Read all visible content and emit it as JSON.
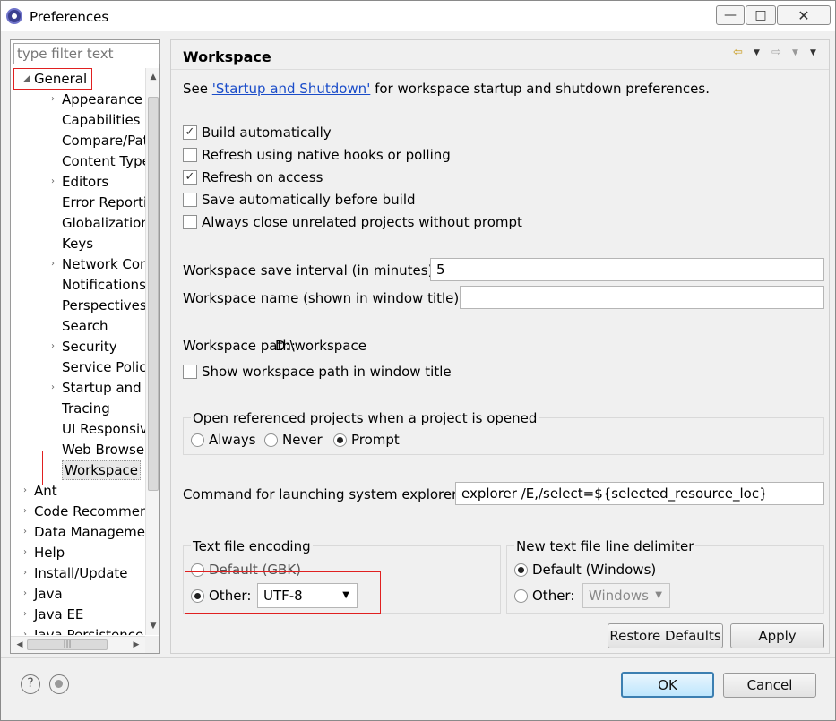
{
  "window": {
    "title": "Preferences",
    "controls": {
      "minimize": "—",
      "maximize": "□",
      "close": "✕"
    }
  },
  "sidebar": {
    "filter_placeholder": "type filter text",
    "items": [
      {
        "label": "General",
        "expander": "◢"
      },
      {
        "label": "Appearance",
        "expander": "›"
      },
      {
        "label": "Capabilities",
        "expander": ""
      },
      {
        "label": "Compare/Patch",
        "expander": ""
      },
      {
        "label": "Content Types",
        "expander": ""
      },
      {
        "label": "Editors",
        "expander": "›"
      },
      {
        "label": "Error Reporting",
        "expander": ""
      },
      {
        "label": "Globalization",
        "expander": ""
      },
      {
        "label": "Keys",
        "expander": ""
      },
      {
        "label": "Network Connections",
        "expander": "›"
      },
      {
        "label": "Notifications",
        "expander": ""
      },
      {
        "label": "Perspectives",
        "expander": ""
      },
      {
        "label": "Search",
        "expander": ""
      },
      {
        "label": "Security",
        "expander": "›"
      },
      {
        "label": "Service Policies",
        "expander": ""
      },
      {
        "label": "Startup and Shutdown",
        "expander": "›"
      },
      {
        "label": "Tracing",
        "expander": ""
      },
      {
        "label": "UI Responsiveness",
        "expander": ""
      },
      {
        "label": "Web Browser",
        "expander": ""
      },
      {
        "label": "Workspace",
        "expander": ""
      },
      {
        "label": "Ant",
        "expander": "›"
      },
      {
        "label": "Code Recommenders",
        "expander": "›"
      },
      {
        "label": "Data Management",
        "expander": "›"
      },
      {
        "label": "Help",
        "expander": "›"
      },
      {
        "label": "Install/Update",
        "expander": "›"
      },
      {
        "label": "Java",
        "expander": "›"
      },
      {
        "label": "Java EE",
        "expander": "›"
      },
      {
        "label": "Java Persistence",
        "expander": "›"
      }
    ],
    "selected": "Workspace",
    "scroll": {
      "up": "▲",
      "down": "▼",
      "left": "◀",
      "right": "▶",
      "grip": "≡",
      "hgrip": "|||"
    }
  },
  "page": {
    "title": "Workspace",
    "nav": {
      "back": "⇦",
      "forward": "⇨",
      "dropdown": "▼",
      "menu": "▼"
    },
    "info_prefix": "See ",
    "info_link": "'Startup and Shutdown'",
    "info_suffix": " for workspace startup and shutdown preferences.",
    "checkboxes": [
      {
        "label": "Build automatically",
        "checked": true,
        "mark": "✓"
      },
      {
        "label": "Refresh using native hooks or polling",
        "checked": false,
        "mark": ""
      },
      {
        "label": "Refresh on access",
        "checked": true,
        "mark": "✓"
      },
      {
        "label": "Save automatically before build",
        "checked": false,
        "mark": ""
      },
      {
        "label": "Always close unrelated projects without prompt",
        "checked": false,
        "mark": ""
      }
    ],
    "save_interval_label": "Workspace save interval (in minutes):",
    "save_interval_value": "5",
    "workspace_name_label": "Workspace name (shown in window title):",
    "workspace_name_value": "",
    "workspace_path_label": "Workspace path:",
    "workspace_path_value": "D:\\workspace",
    "show_path_label": "Show workspace path in window title",
    "open_projects": {
      "title": "Open referenced projects when a project is opened",
      "options": [
        "Always",
        "Never",
        "Prompt"
      ],
      "selected": "Prompt"
    },
    "explorer_label": "Command for launching system explorer:",
    "explorer_value": "explorer /E,/select=${selected_resource_loc}",
    "encoding": {
      "title": "Text file encoding",
      "default_label": "Default (GBK)",
      "other_label": "Other:",
      "other_value": "UTF-8",
      "selected": "Other"
    },
    "line_delimiter": {
      "title": "New text file line delimiter",
      "default_label": "Default (Windows)",
      "other_label": "Other:",
      "other_value": "Windows",
      "selected": "Default"
    },
    "restore_defaults": "Restore Defaults",
    "apply": "Apply"
  },
  "footer": {
    "help_icon": "?",
    "ok": "OK",
    "cancel": "Cancel"
  }
}
